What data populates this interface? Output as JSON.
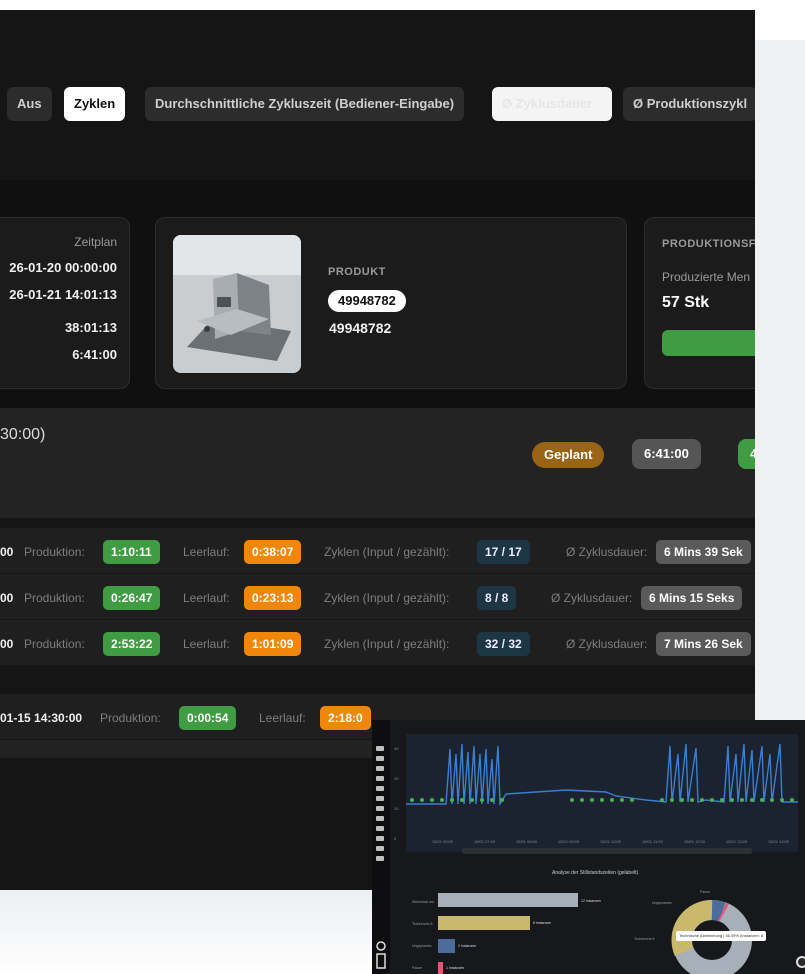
{
  "tabs": [
    {
      "label": "Aus",
      "state": "inactive"
    },
    {
      "label": "Zyklen",
      "state": "active"
    },
    {
      "label": "Durchschnittliche Zykluszeit (Bediener-Eingabe)",
      "state": "inactive"
    },
    {
      "label": "Ø Zyklusdauer",
      "state": "inactive"
    },
    {
      "label": "Ø Produktionszykl",
      "state": "inactive"
    }
  ],
  "zeitplan": {
    "title": "Zeitplan",
    "start": "26-01-20 00:00:00",
    "end": "26-01-21 14:01:13",
    "duration": "38:01:13",
    "planned": "6:41:00"
  },
  "produkt": {
    "label": "PRODUKT",
    "pill": "49948782",
    "number": "49948782",
    "image_icon": "workpiece-photo"
  },
  "produktionsfortschritt": {
    "label": "PRODUKTIONSF",
    "sub_label": "Produzierte Men",
    "value": "57 Stk",
    "progress_fraction": 1.0
  },
  "summary": {
    "time_paren": "30:00)",
    "status": "Geplant",
    "time": "6:41:00",
    "green_partial": "4"
  },
  "labels": {
    "produktion": "Produktion:",
    "leerlauf": "Leerlauf:",
    "zyklen": "Zyklen (Input / gezählt):",
    "zyklusdauer": "Ø Zyklusdauer:"
  },
  "rows": [
    {
      "start": "00",
      "produktion": "1:10:11",
      "leerlauf": "0:38:07",
      "zyklen": "17 / 17",
      "dauer": "6 Mins 39 Sek"
    },
    {
      "start": "00",
      "produktion": "0:26:47",
      "leerlauf": "0:23:13",
      "zyklen": "8 / 8",
      "dauer": "6 Mins 15 Seks"
    },
    {
      "start": "00",
      "produktion": "2:53:22",
      "leerlauf": "1:01:09",
      "zyklen": "32 / 32",
      "dauer": "7 Mins 26 Sek"
    },
    {
      "start": "01-15 14:30:00",
      "produktion": "0:00:54",
      "leerlauf": "2:18:0"
    }
  ],
  "thumbnail": {
    "chart_y_ticks": [
      "30",
      "20",
      "10",
      "0"
    ],
    "chart_x_ticks": [
      "15/01 06:00",
      "15/01 07:00",
      "15/01 08:00",
      "15/01 09:00",
      "15/01 10:00",
      "15/01 11:00",
      "15/01 12:00",
      "15/01 13:00",
      "15/01 14:00"
    ],
    "analysis_title": "Analyse der Stillstandszeiten (gelabelt)",
    "bars": [
      {
        "label": "Werkstück am",
        "value": "12 Instanzen",
        "color": "#a7b0b8",
        "fraction": 1.0
      },
      {
        "label": "Technische A",
        "value": "8 Instanzen",
        "color": "#c8b96c",
        "fraction": 0.66
      },
      {
        "label": "Ungeplantes",
        "value": "2 Instanzen",
        "color": "#4c6c9c",
        "fraction": 0.12
      },
      {
        "label": "Pause",
        "value": "1 Instanzen",
        "color": "#e0577a",
        "fraction": 0.04
      }
    ],
    "donut_labels": [
      "Pause",
      "Ungeplantes",
      "Technische A"
    ],
    "tooltip": "Technische Abstimmung | 36.09% (Instanzen: 8"
  }
}
